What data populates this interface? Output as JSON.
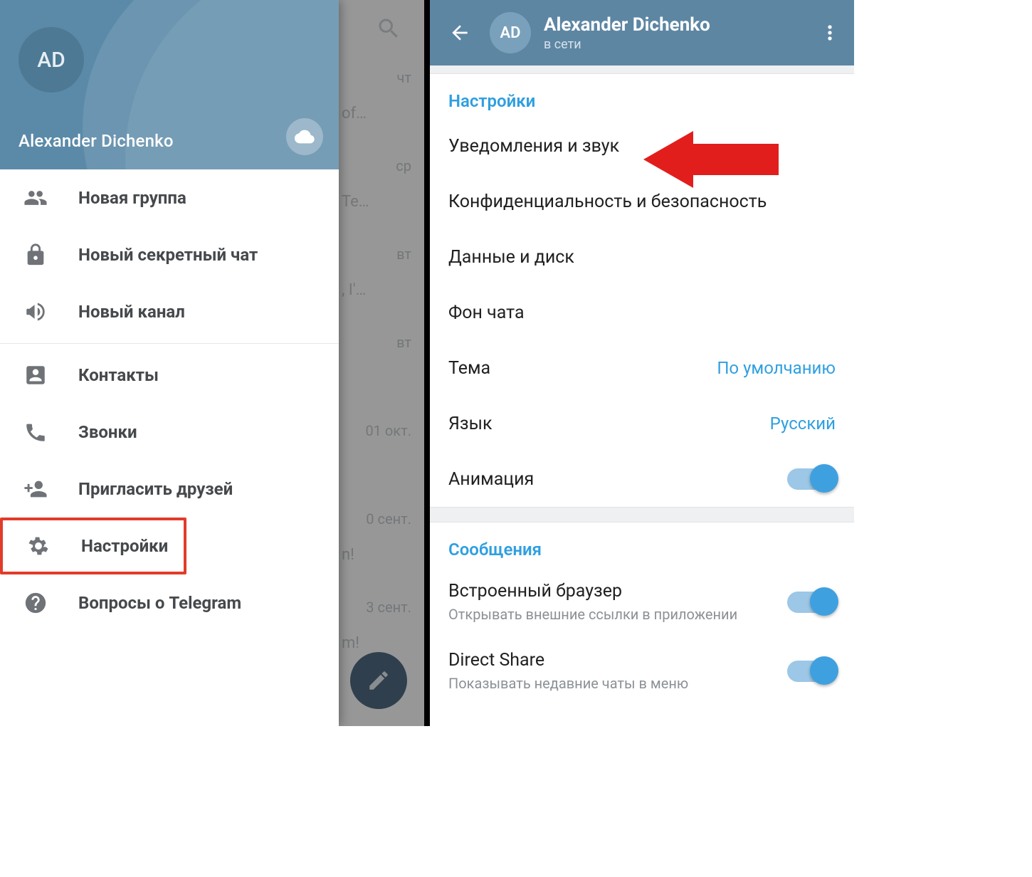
{
  "left": {
    "avatar_initials": "AD",
    "user_name": "Alexander Dichenko",
    "menu": [
      {
        "key": "new-group",
        "label": "Новая группа"
      },
      {
        "key": "new-secret-chat",
        "label": "Новый секретный чат"
      },
      {
        "key": "new-channel",
        "label": "Новый канал"
      },
      {
        "key": "contacts",
        "label": "Контакты"
      },
      {
        "key": "calls",
        "label": "Звонки"
      },
      {
        "key": "invite-friends",
        "label": "Пригласить друзей"
      },
      {
        "key": "settings",
        "label": "Настройки"
      },
      {
        "key": "faq",
        "label": "Вопросы о Telegram"
      }
    ],
    "chat_frags": [
      {
        "day": "чт",
        "frag": "of…"
      },
      {
        "day": "ср",
        "frag": "Te…"
      },
      {
        "day": "вт",
        "frag": ", I'…"
      },
      {
        "day": "вт",
        "frag": ""
      },
      {
        "day": "01 окт.",
        "frag": ""
      },
      {
        "day": "0 сент.",
        "frag": "n!"
      },
      {
        "day": "3 сент.",
        "frag": "m!"
      }
    ]
  },
  "right": {
    "avatar_initials": "AD",
    "title": "Alexander Dichenko",
    "subtitle": "в сети",
    "section1_header": "Настройки",
    "section2_header": "Сообщения",
    "rows": {
      "notifications": "Уведомления и звук",
      "privacy": "Конфиденциальность и безопасность",
      "data": "Данные и диск",
      "background": "Фон чата",
      "theme_label": "Тема",
      "theme_value": "По умолчанию",
      "language_label": "Язык",
      "language_value": "Русский",
      "animation": "Анимация",
      "browser_label": "Встроенный браузер",
      "browser_desc": "Открывать внешние ссылки в приложении",
      "directshare_label": "Direct Share",
      "directshare_desc": "Показывать недавние чаты в меню"
    }
  }
}
